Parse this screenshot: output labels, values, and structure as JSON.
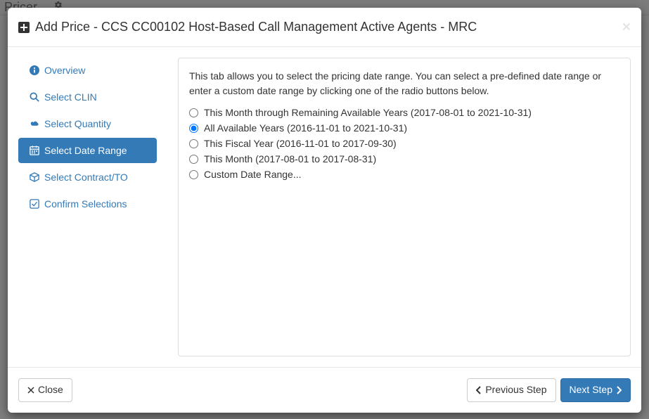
{
  "background": {
    "pricer_label": "Pricer",
    "tools_label": "Tools"
  },
  "modal": {
    "title": "Add Price - CCS CC00102 Host-Based Call Management Active Agents - MRC",
    "close_label": "×"
  },
  "sidebar": {
    "items": [
      {
        "label": "Overview"
      },
      {
        "label": "Select CLIN"
      },
      {
        "label": "Select Quantity"
      },
      {
        "label": "Select Date Range"
      },
      {
        "label": "Select Contract/TO"
      },
      {
        "label": "Confirm Selections"
      }
    ]
  },
  "panel": {
    "intro": "This tab allows you to select the pricing date range. You can select a pre-defined date range or enter a custom date range by clicking one of the radio buttons below.",
    "options": [
      {
        "label": "This Month through Remaining Available Years (2017-08-01 to 2021-10-31)"
      },
      {
        "label": "All Available Years (2016-11-01 to 2021-10-31)"
      },
      {
        "label": "This Fiscal Year (2016-11-01 to 2017-09-30)"
      },
      {
        "label": "This Month (2017-08-01 to 2017-08-31)"
      },
      {
        "label": "Custom Date Range..."
      }
    ],
    "selected_index": 1
  },
  "footer": {
    "close_label": "Close",
    "prev_label": "Previous Step",
    "next_label": "Next Step"
  }
}
